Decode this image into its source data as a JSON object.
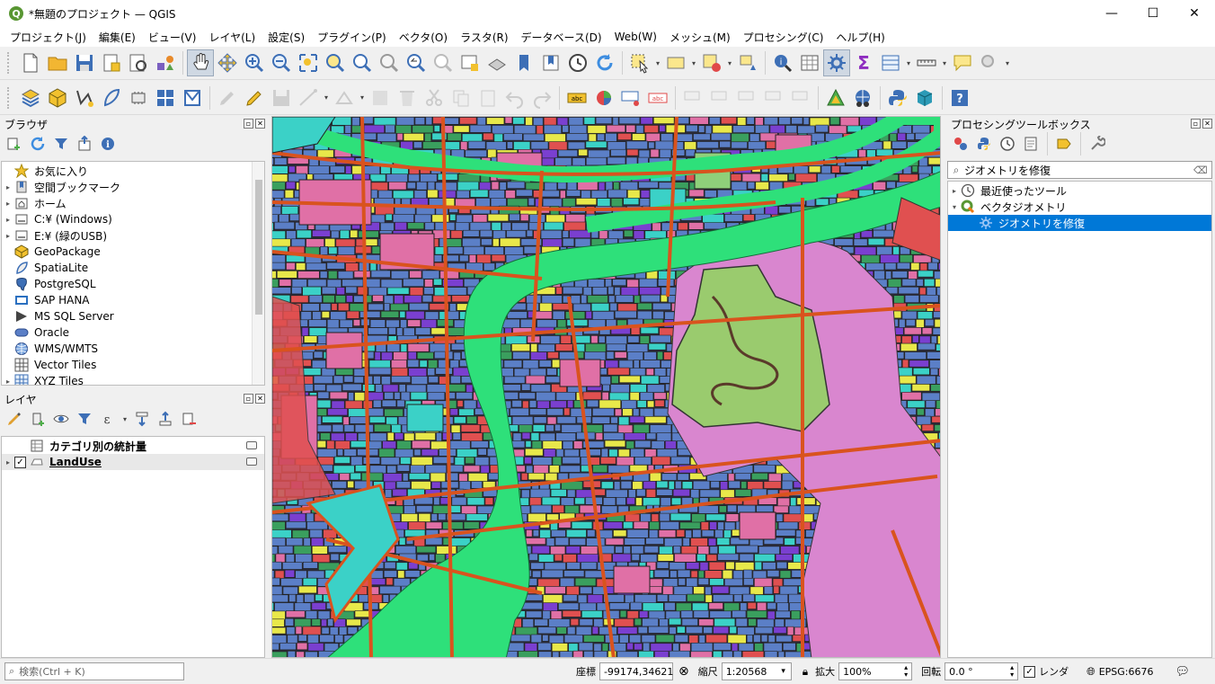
{
  "window": {
    "title": "*無題のプロジェクト — QGIS",
    "logo_letter": "Q",
    "minimize": "—",
    "maximize": "☐",
    "close": "✕"
  },
  "menu": [
    "プロジェクト(J)",
    "編集(E)",
    "ビュー(V)",
    "レイヤ(L)",
    "設定(S)",
    "プラグイン(P)",
    "ベクタ(O)",
    "ラスタ(R)",
    "データベース(D)",
    "Web(W)",
    "メッシュ(M)",
    "プロセシング(C)",
    "ヘルプ(H)"
  ],
  "browser": {
    "title": "ブラウザ",
    "items": [
      {
        "label": "お気に入り",
        "icon": "star-icon",
        "expand": ""
      },
      {
        "label": "空間ブックマーク",
        "icon": "bookmark-icon",
        "expand": "▸"
      },
      {
        "label": "ホーム",
        "icon": "home-icon",
        "expand": "▸"
      },
      {
        "label": "C:¥ (Windows)",
        "icon": "drive-icon",
        "expand": "▸"
      },
      {
        "label": "E:¥ (緑のUSB)",
        "icon": "drive-icon",
        "expand": "▸"
      },
      {
        "label": "GeoPackage",
        "icon": "geopackage-icon",
        "expand": ""
      },
      {
        "label": "SpatiaLite",
        "icon": "spatialite-icon",
        "expand": ""
      },
      {
        "label": "PostgreSQL",
        "icon": "postgresql-icon",
        "expand": ""
      },
      {
        "label": "SAP HANA",
        "icon": "saphana-icon",
        "expand": ""
      },
      {
        "label": "MS SQL Server",
        "icon": "mssql-icon",
        "expand": ""
      },
      {
        "label": "Oracle",
        "icon": "oracle-icon",
        "expand": ""
      },
      {
        "label": "WMS/WMTS",
        "icon": "globe-icon",
        "expand": ""
      },
      {
        "label": "Vector Tiles",
        "icon": "vector-tiles-icon",
        "expand": ""
      },
      {
        "label": "XYZ Tiles",
        "icon": "xyz-tiles-icon",
        "expand": "▸"
      }
    ]
  },
  "layers": {
    "title": "レイヤ",
    "items": [
      {
        "label": "カテゴリ別の統計量",
        "icon": "table-icon",
        "checked": false,
        "bold": true
      },
      {
        "label": "LandUse",
        "icon": "polygon-layer-icon",
        "checked": true,
        "bold": true,
        "underline": true
      }
    ],
    "check_mark": "✓"
  },
  "processing": {
    "title": "プロセシングツールボックス",
    "search_value": "ジオメトリを修復",
    "clear_icon": "⌫",
    "items": [
      {
        "label": "最近使ったツール",
        "icon": "clock-icon",
        "expand": "▸",
        "indent": 0
      },
      {
        "label": "ベクタジオメトリ",
        "icon": "qgis-icon",
        "expand": "▾",
        "indent": 0
      },
      {
        "label": "ジオメトリを修復",
        "icon": "gear-icon",
        "expand": "",
        "indent": 1,
        "selected": true
      }
    ]
  },
  "status": {
    "search_placeholder": "検索(Ctrl + K)",
    "coord_label": "座標",
    "coord_value": "-99174,34621",
    "scale_label": "縮尺",
    "scale_value": "1:20568",
    "magnifier_label": "拡大",
    "magnifier_value": "100%",
    "rotation_label": "回転",
    "rotation_value": "0.0 °",
    "render_label": "レンダ",
    "render_checked": "✓",
    "crs": "EPSG:6676"
  },
  "colors": {
    "accent": "#0078d7",
    "landuse_blue": "#5b7fc7",
    "river_green": "#2ee07a",
    "road": "#d9531e",
    "park": "#9acb6e",
    "pink": "#e070a6",
    "cyan": "#3bd1c7"
  }
}
